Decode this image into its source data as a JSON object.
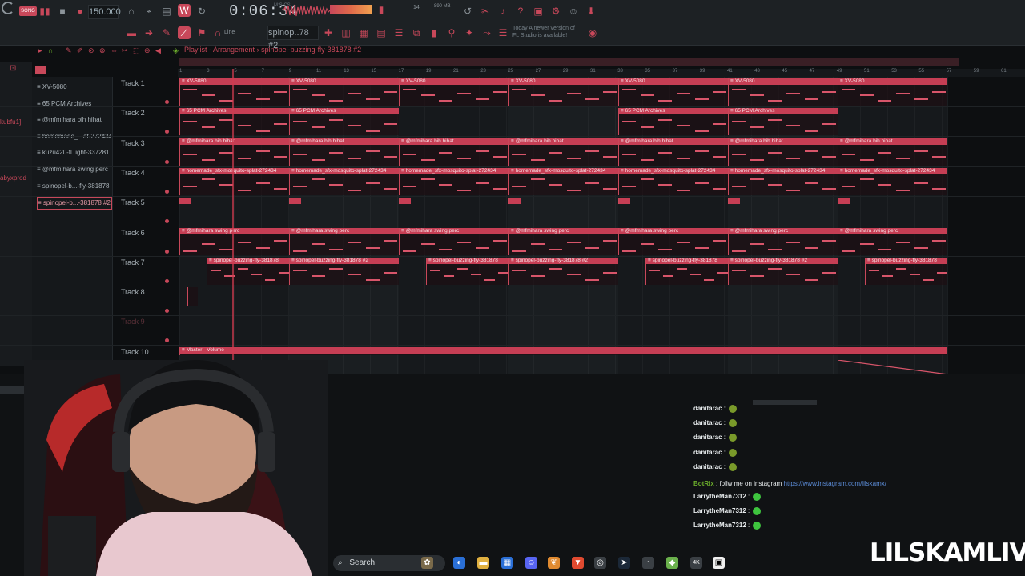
{
  "toolbar": {
    "song_mode": "SONG",
    "tempo": "150.000",
    "time": "0:06:34",
    "time_unit": "M:S:CS",
    "cpu_memory": "14",
    "ram": "890 MB",
    "snap": "Line",
    "pattern": "spinop..78 #2",
    "news_line1": "Today  A newer version of",
    "news_line2": "FL Studio is available!"
  },
  "playlist": {
    "title": "Playlist - Arrangement",
    "separator": "›",
    "pattern_name": "spinopel-buzzing-fly-381878 #2",
    "ruler_numbers": [
      "1",
      "3",
      "5",
      "7",
      "9",
      "11",
      "13",
      "15",
      "17",
      "19",
      "21",
      "23",
      "25",
      "27",
      "29",
      "31",
      "33",
      "35",
      "37",
      "39",
      "41",
      "43",
      "45",
      "47",
      "49",
      "51",
      "53",
      "55",
      "57",
      "59",
      "61"
    ]
  },
  "sidebar_tags": [
    "kubfu1]",
    "abyxprod"
  ],
  "pattern_list": [
    "XV-5080",
    "65 PCM Archives",
    "@mfmihara bih hihat",
    "homemade_...at-272434",
    "kuzu420-fl..ight-337281",
    "@mfmihara swing perc",
    "spinopel-b...-fly-381878",
    "spinopel-b...-381878 #2"
  ],
  "tracks": [
    {
      "label": "Track 1",
      "clips": [
        {
          "name": "XV-5080"
        },
        {
          "name": "XV-5080"
        },
        {
          "name": "XV-5080"
        },
        {
          "name": "XV-5080"
        },
        {
          "name": "XV-5080"
        },
        {
          "name": "XV-5080"
        },
        {
          "name": "XV-5080"
        }
      ]
    },
    {
      "label": "Track 2",
      "clips": [
        {
          "name": "65 PCM Archives"
        },
        {
          "name": "65 PCM Archives"
        },
        {
          "name": "65 PCM Archives"
        },
        {
          "name": "65 PCM Archives"
        }
      ]
    },
    {
      "label": "Track 3",
      "clips": [
        {
          "name": "@mfmihara bih hihat"
        },
        {
          "name": "@mfmihara bih hihat"
        },
        {
          "name": "@mfmihara bih hihat"
        },
        {
          "name": "@mfmihara bih hihat"
        },
        {
          "name": "@mfmihara bih hihat"
        },
        {
          "name": "@mfmihara bih hihat"
        },
        {
          "name": "@mfmihara bih hihat"
        }
      ]
    },
    {
      "label": "Track 4",
      "clips": [
        {
          "name": "homemade_sfx-mosquito-splat-272434"
        },
        {
          "name": "homemade_sfx-mosquito-splat-272434"
        },
        {
          "name": "homemade_sfx-mosquito-splat-272434"
        },
        {
          "name": "homemade_sfx-mosquito-splat-272434"
        },
        {
          "name": "homemade_sfx-mosquito-splat-272434"
        },
        {
          "name": "homemade_sfx-mosquito-splat-272434"
        },
        {
          "name": "homemade_sfx-mosquito-splat-272434"
        }
      ]
    },
    {
      "label": "Track 5",
      "clips": []
    },
    {
      "label": "Track 6",
      "clips": [
        {
          "name": "@mfmihara swing perc"
        },
        {
          "name": "@mfmihara swing perc"
        },
        {
          "name": "@mfmihara swing perc"
        },
        {
          "name": "@mfmihara swing perc"
        },
        {
          "name": "@mfmihara swing perc"
        },
        {
          "name": "@mfmihara swing perc"
        },
        {
          "name": "@mfmihara swing perc"
        }
      ]
    },
    {
      "label": "Track 7",
      "clips": [
        {
          "name": "spinopel-buzzing-fly-381878"
        },
        {
          "name": "spinopel-buzzing-fly-381878 #2"
        },
        {
          "name": "spinopel-buzzing-fly-381878"
        },
        {
          "name": "spinopel-buzzing-fly-381878 #2"
        },
        {
          "name": "spinopel-buzzing-fly-381878"
        },
        {
          "name": "spinopel-buzzing-fly-381878 #2"
        },
        {
          "name": "spinopel-buzzing-fly-381878"
        }
      ]
    },
    {
      "label": "Track 8",
      "clips": []
    },
    {
      "label": "Track 9",
      "clips": []
    },
    {
      "label": "Track 10",
      "clips": [
        {
          "name": "Master - Volume"
        }
      ]
    }
  ],
  "chat": [
    {
      "user": "danitarac",
      "sep": " :",
      "msg": "",
      "emote": "frog"
    },
    {
      "user": "danitarac",
      "sep": " :",
      "msg": "",
      "emote": "frog"
    },
    {
      "user": "danitarac",
      "sep": " :",
      "msg": "",
      "emote": "frog"
    },
    {
      "user": "danitarac",
      "sep": " :",
      "msg": "",
      "emote": "frog"
    },
    {
      "user": "danitarac",
      "sep": " :",
      "msg": "",
      "emote": "frog"
    },
    {
      "user": "BotRix",
      "sep": " :",
      "msg": " follw me on instagram ",
      "link": "https://www.instagram.com/lilskamx/"
    },
    {
      "user": "LarrytheMan7312",
      "sep": " :",
      "msg": "",
      "emote": "ghost"
    },
    {
      "user": "LarrytheMan7312",
      "sep": " :",
      "msg": "",
      "emote": "ghost"
    },
    {
      "user": "LarrytheMan7312",
      "sep": " :",
      "msg": "",
      "emote": "ghost"
    }
  ],
  "taskbar": {
    "search_label": "Search"
  },
  "brand": "LILSKAMLIVE",
  "colors": {
    "accent": "#c63e54",
    "bg": "#0d0f11"
  }
}
